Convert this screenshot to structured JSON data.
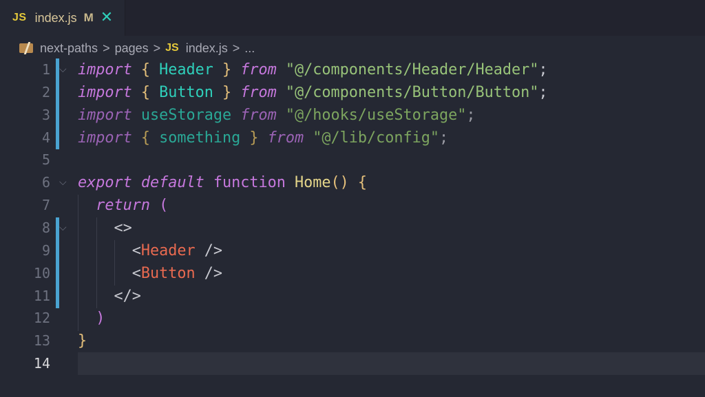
{
  "tab": {
    "icon": "JS",
    "filename": "index.js",
    "status": "M",
    "close_icon": "✕"
  },
  "breadcrumb": {
    "items": [
      "next-paths",
      "pages",
      "index.js",
      "..."
    ],
    "file_icon": "JS",
    "separator": ">"
  },
  "editor": {
    "current_line": 14,
    "line_numbers": [
      "1",
      "2",
      "3",
      "4",
      "5",
      "6",
      "7",
      "8",
      "9",
      "10",
      "11",
      "12",
      "13",
      "14"
    ],
    "lines": [
      [
        [
          "kw",
          "import"
        ],
        [
          "pun",
          " "
        ],
        [
          "br",
          "{"
        ],
        [
          "pun",
          " "
        ],
        [
          "id",
          "Header"
        ],
        [
          "pun",
          " "
        ],
        [
          "br",
          "}"
        ],
        [
          "pun",
          " "
        ],
        [
          "kw",
          "from"
        ],
        [
          "pun",
          " "
        ],
        [
          "str",
          "\"@/components/Header/Header\""
        ],
        [
          "pun",
          ";"
        ]
      ],
      [
        [
          "kw",
          "import"
        ],
        [
          "pun",
          " "
        ],
        [
          "br",
          "{"
        ],
        [
          "pun",
          " "
        ],
        [
          "id",
          "Button"
        ],
        [
          "pun",
          " "
        ],
        [
          "br",
          "}"
        ],
        [
          "pun",
          " "
        ],
        [
          "kw",
          "from"
        ],
        [
          "pun",
          " "
        ],
        [
          "str",
          "\"@/components/Button/Button\""
        ],
        [
          "pun",
          ";"
        ]
      ],
      [
        [
          "kwd",
          "import"
        ],
        [
          "pun",
          " "
        ],
        [
          "idd",
          "useStorage"
        ],
        [
          "pun",
          " "
        ],
        [
          "kwd",
          "from"
        ],
        [
          "pun",
          " "
        ],
        [
          "strd",
          "\"@/hooks/useStorage\""
        ],
        [
          "pund",
          ";"
        ]
      ],
      [
        [
          "kwd",
          "import"
        ],
        [
          "pun",
          " "
        ],
        [
          "brd",
          "{"
        ],
        [
          "pun",
          " "
        ],
        [
          "idd",
          "something"
        ],
        [
          "pun",
          " "
        ],
        [
          "brd",
          "}"
        ],
        [
          "pun",
          " "
        ],
        [
          "kwd",
          "from"
        ],
        [
          "pun",
          " "
        ],
        [
          "strd",
          "\"@/lib/config\""
        ],
        [
          "pund",
          ";"
        ]
      ],
      [],
      [
        [
          "kw",
          "export"
        ],
        [
          "pun",
          " "
        ],
        [
          "kw",
          "default"
        ],
        [
          "pun",
          " "
        ],
        [
          "fn",
          "function"
        ],
        [
          "pun",
          " "
        ],
        [
          "fnname",
          "Home"
        ],
        [
          "br",
          "()"
        ],
        [
          "pun",
          " "
        ],
        [
          "br",
          "{"
        ]
      ],
      [
        [
          "pun",
          "  "
        ],
        [
          "kw",
          "return"
        ],
        [
          "pun",
          " "
        ],
        [
          "paren",
          "("
        ]
      ],
      [
        [
          "pun",
          "    "
        ],
        [
          "pun",
          "<>"
        ]
      ],
      [
        [
          "pun",
          "      "
        ],
        [
          "pun",
          "<"
        ],
        [
          "tag",
          "Header"
        ],
        [
          "pun",
          " />"
        ]
      ],
      [
        [
          "pun",
          "      "
        ],
        [
          "pun",
          "<"
        ],
        [
          "tag",
          "Button"
        ],
        [
          "pun",
          " />"
        ]
      ],
      [
        [
          "pun",
          "    "
        ],
        [
          "pun",
          "</>"
        ]
      ],
      [
        [
          "pun",
          "  "
        ],
        [
          "paren",
          ")"
        ]
      ],
      [
        [
          "br",
          "}"
        ]
      ],
      []
    ]
  }
}
